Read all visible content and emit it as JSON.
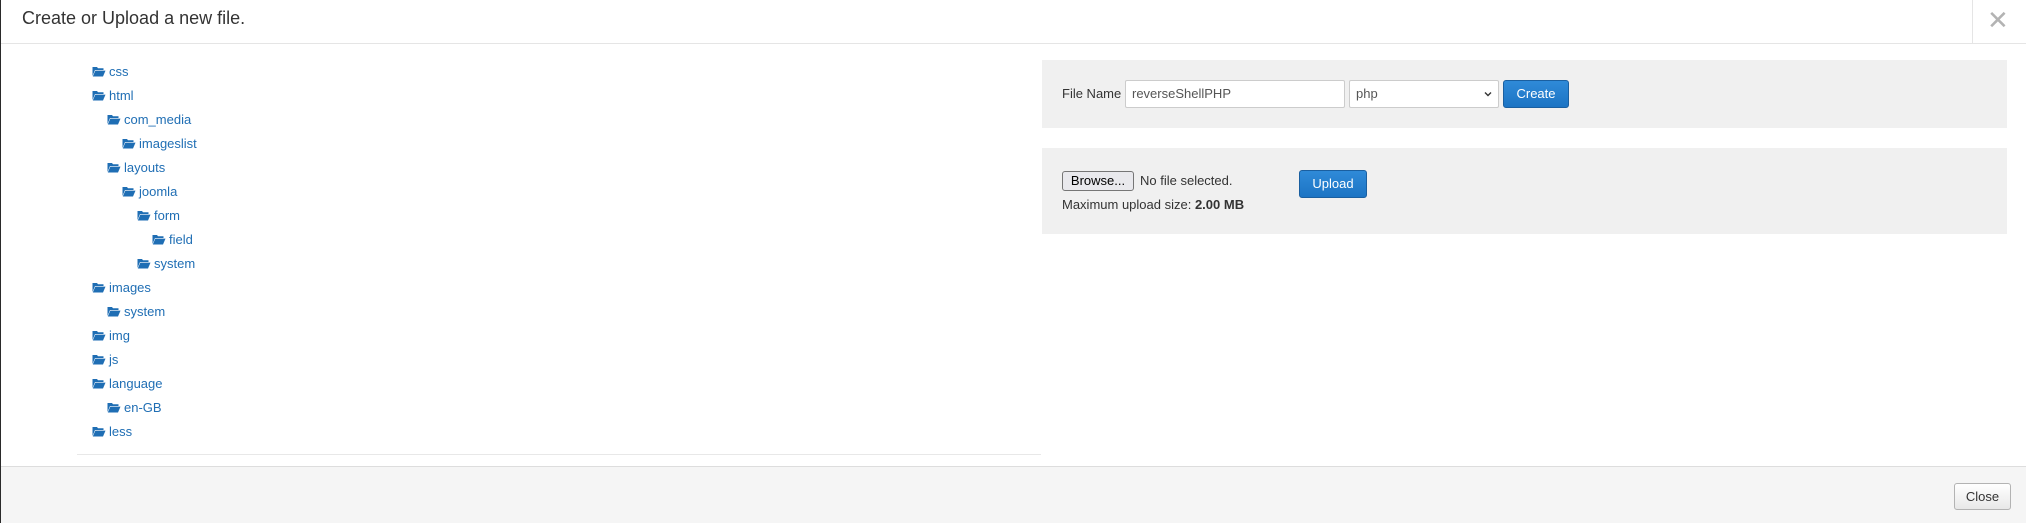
{
  "modal": {
    "title": "Create or Upload a new file.",
    "close_symbol": "✕"
  },
  "tree": {
    "items": [
      {
        "label": "css",
        "depth": 0
      },
      {
        "label": "html",
        "depth": 0
      },
      {
        "label": "com_media",
        "depth": 1
      },
      {
        "label": "imageslist",
        "depth": 2
      },
      {
        "label": "layouts",
        "depth": 1
      },
      {
        "label": "joomla",
        "depth": 2
      },
      {
        "label": "form",
        "depth": 3
      },
      {
        "label": "field",
        "depth": 4
      },
      {
        "label": "system",
        "depth": 3
      },
      {
        "label": "images",
        "depth": 0
      },
      {
        "label": "system",
        "depth": 1
      },
      {
        "label": "img",
        "depth": 0
      },
      {
        "label": "js",
        "depth": 0
      },
      {
        "label": "language",
        "depth": 0
      },
      {
        "label": "en-GB",
        "depth": 1
      },
      {
        "label": "less",
        "depth": 0
      }
    ],
    "icon": "folder-open-icon",
    "link_color": "#1f6eb4"
  },
  "create": {
    "file_name_label": "File Name",
    "file_name_value": "reverseShellPHP",
    "type_selected": "php",
    "create_label": "Create"
  },
  "upload": {
    "browse_label": "Browse...",
    "no_file_text": "No file selected.",
    "upload_label": "Upload",
    "max_size_label": "Maximum upload size:",
    "max_size_value": "2.00 MB"
  },
  "footer": {
    "close_label": "Close"
  },
  "colors": {
    "primary": "#1c74c4",
    "panel_bg": "#f0f0f0"
  }
}
